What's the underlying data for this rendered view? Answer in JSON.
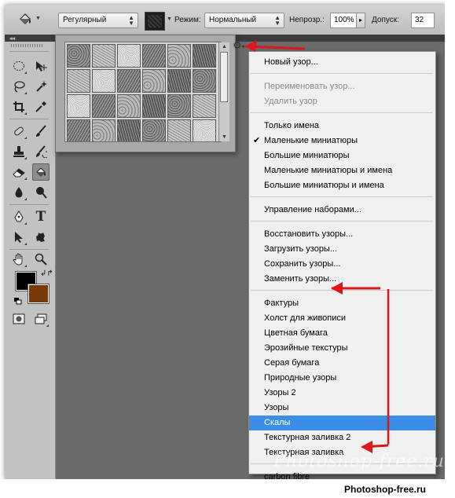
{
  "options_bar": {
    "tool_icon": "paint-bucket-icon",
    "fill_source": "Регулярный",
    "pattern_swatch_icon": "pattern-swatch-icon",
    "mode_label": "Режим:",
    "mode_value": "Нормальный",
    "opacity_label": "Непрозр.:",
    "opacity_value": "100%",
    "tolerance_label": "Допуск:",
    "tolerance_value": "32"
  },
  "pattern_picker": {
    "settings_icon": "gear-icon",
    "pattern_count_visible": 24
  },
  "toolbox": {
    "tools": [
      "marquee-icon",
      "move-icon",
      "lasso-icon",
      "magic-wand-icon",
      "crop-icon",
      "eyedropper-icon",
      "healing-brush-icon",
      "brush-icon",
      "clone-stamp-icon",
      "history-brush-icon",
      "eraser-icon",
      "paint-bucket-icon",
      "blur-icon",
      "dodge-icon",
      "pen-icon",
      "type-icon",
      "path-selection-icon",
      "custom-shape-icon",
      "hand-icon",
      "zoom-icon"
    ],
    "foreground_color": "#000000",
    "background_color": "#7a3a08"
  },
  "menu": {
    "items": [
      {
        "label": "Новый узор...",
        "state": "normal"
      },
      {
        "label": "Переименовать узор...",
        "state": "disabled"
      },
      {
        "label": "Удалить узор",
        "state": "disabled"
      },
      {
        "label": "Только имена",
        "state": "normal"
      },
      {
        "label": "Маленькие миниатюры",
        "state": "checked"
      },
      {
        "label": "Большие миниатюры",
        "state": "normal"
      },
      {
        "label": "Маленькие миниатюры и имена",
        "state": "normal"
      },
      {
        "label": "Большие миниатюры и имена",
        "state": "normal"
      },
      {
        "label": "Управление наборами...",
        "state": "normal"
      },
      {
        "label": "Восстановить узоры...",
        "state": "normal"
      },
      {
        "label": "Загрузить узоры...",
        "state": "normal"
      },
      {
        "label": "Сохранить узоры...",
        "state": "normal"
      },
      {
        "label": "Заменить узоры...",
        "state": "normal"
      },
      {
        "label": "Фактуры",
        "state": "normal"
      },
      {
        "label": "Холст для живописи",
        "state": "normal"
      },
      {
        "label": "Цветная бумага",
        "state": "normal"
      },
      {
        "label": "Эрозийные текстуры",
        "state": "normal"
      },
      {
        "label": "Серая бумага",
        "state": "normal"
      },
      {
        "label": "Природные узоры",
        "state": "normal"
      },
      {
        "label": "Узоры 2",
        "state": "normal"
      },
      {
        "label": "Узоры",
        "state": "normal"
      },
      {
        "label": "Скалы",
        "state": "highlighted"
      },
      {
        "label": "Текстурная заливка 2",
        "state": "normal"
      },
      {
        "label": "Текстурная заливка",
        "state": "normal"
      },
      {
        "label": "carbon fibre",
        "state": "normal"
      }
    ]
  },
  "watermark": "Photoshop-free.ru",
  "credit": "Photoshop-free.ru",
  "colors": {
    "highlight": "#3a8ee6",
    "annotation_arrow": "#e0141b"
  }
}
